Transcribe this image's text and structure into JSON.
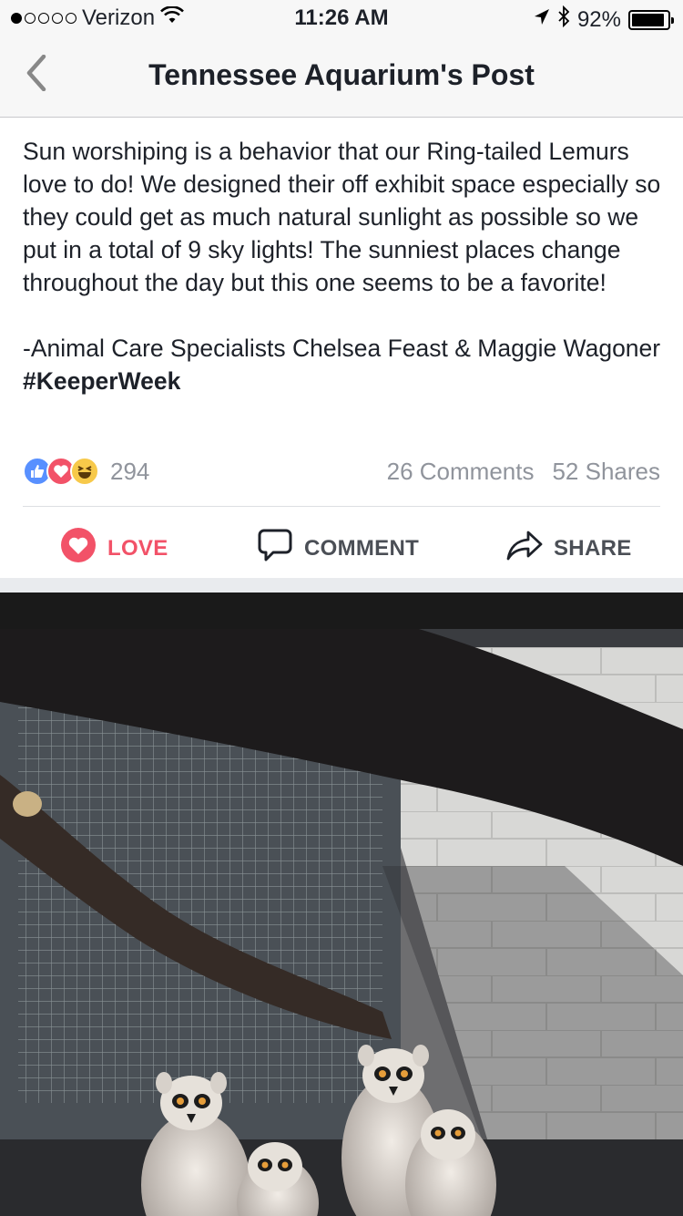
{
  "status_bar": {
    "carrier": "Verizon",
    "time": "11:26 AM",
    "battery_percent": "92%",
    "battery_level": 0.92,
    "signal_bars_filled": 1,
    "signal_bars_total": 5
  },
  "nav": {
    "title": "Tennessee Aquarium's Post",
    "back_icon": "chevron-left-icon"
  },
  "post": {
    "paragraph_1": "Sun worshiping is a behavior that our Ring-tailed Lemurs love to do! We designed their off exhibit space especially so they could get as much natural sunlight as possible so we put in a total of 9 sky lights! The sunniest places change throughout the day but this one seems to be a favorite!",
    "signature": "-Animal Care Specialists Chelsea Feast & Maggie Wagoner ",
    "hashtag": "#KeeperWeek"
  },
  "reactions": {
    "count": "294",
    "types": [
      "like-icon",
      "love-icon",
      "haha-icon"
    ],
    "comments": "26 Comments",
    "shares": "52 Shares"
  },
  "actions": {
    "love": "LOVE",
    "comment": "COMMENT",
    "share": "SHARE"
  },
  "colors": {
    "love": "#f25268",
    "like": "#5890ff",
    "haha": "#f7c94a",
    "muted": "#90949c"
  }
}
